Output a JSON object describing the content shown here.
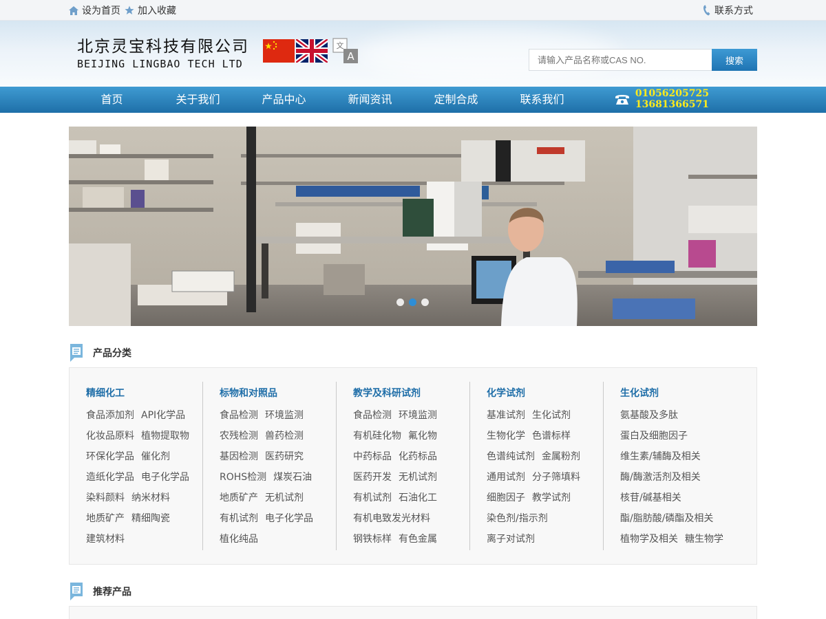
{
  "topbar": {
    "set_home": "设为首页",
    "add_favorite": "加入收藏",
    "contact": "联系方式"
  },
  "header": {
    "company_cn": "北京灵宝科技有限公司",
    "company_en": "BEIJING LINGBAO TECH LTD",
    "search_placeholder": "请输入产品名称或CAS NO.",
    "search_button": "搜索"
  },
  "nav": {
    "items": [
      "首页",
      "关于我们",
      "产品中心",
      "新闻资讯",
      "定制合成",
      "联系我们"
    ],
    "phone1": "01056205725",
    "phone2": "13681366571"
  },
  "banner": {
    "slide_count": 3,
    "active_slide": 2
  },
  "sections": {
    "categories_title": "产品分类",
    "recommended_title": "推荐产品"
  },
  "categories": [
    {
      "title": "精细化工",
      "rows": [
        [
          "食品添加剂",
          "API化学品"
        ],
        [
          "化妆品原料",
          "植物提取物"
        ],
        [
          "环保化学品",
          "催化剂"
        ],
        [
          "造纸化学品",
          "电子化学品"
        ],
        [
          "染料颜料",
          "纳米材料"
        ],
        [
          "地质矿产",
          "精细陶瓷"
        ],
        [
          "建筑材料"
        ]
      ]
    },
    {
      "title": "标物和对照品",
      "rows": [
        [
          "食品检测",
          "环境监测"
        ],
        [
          "农残检测",
          "兽药检测"
        ],
        [
          "基因检测",
          "医药研究"
        ],
        [
          "ROHS检测",
          "煤炭石油"
        ],
        [
          "地质矿产",
          "无机试剂"
        ],
        [
          "有机试剂",
          "电子化学品"
        ],
        [
          "植化纯品"
        ]
      ]
    },
    {
      "title": "教学及科研试剂",
      "rows": [
        [
          "食品检测",
          "环境监测"
        ],
        [
          "有机硅化物",
          "氟化物"
        ],
        [
          "中药标品",
          "化药标品"
        ],
        [
          "医药开发",
          "无机试剂"
        ],
        [
          "有机试剂",
          "石油化工"
        ],
        [
          "有机电致发光材料"
        ],
        [
          "钢铁标样",
          "有色金属"
        ]
      ]
    },
    {
      "title": "化学试剂",
      "rows": [
        [
          "基准试剂",
          "生化试剂"
        ],
        [
          "生物化学",
          "色谱标样"
        ],
        [
          "色谱纯试剂",
          "金属粉剂"
        ],
        [
          "通用试剂",
          "分子筛填料"
        ],
        [
          "细胞因子",
          "教学试剂"
        ],
        [
          "染色剂/指示剂"
        ],
        [
          "离子对试剂"
        ]
      ]
    },
    {
      "title": "生化试剂",
      "rows": [
        [
          "氨基酸及多肽"
        ],
        [
          "蛋白及细胞因子"
        ],
        [
          "维生素/辅酶及相关"
        ],
        [
          "酶/酶激活剂及相关"
        ],
        [
          "核苷/碱基相关"
        ],
        [
          "酯/脂肪酸/磷酯及相关"
        ],
        [
          "植物学及相关",
          "糖生物学"
        ]
      ]
    }
  ],
  "colors": {
    "nav_blue": "#1e6fa8",
    "accent_blue": "#2e8ed6",
    "phone_yellow": "#ffeb1a",
    "category_title": "#1f6ea8"
  }
}
